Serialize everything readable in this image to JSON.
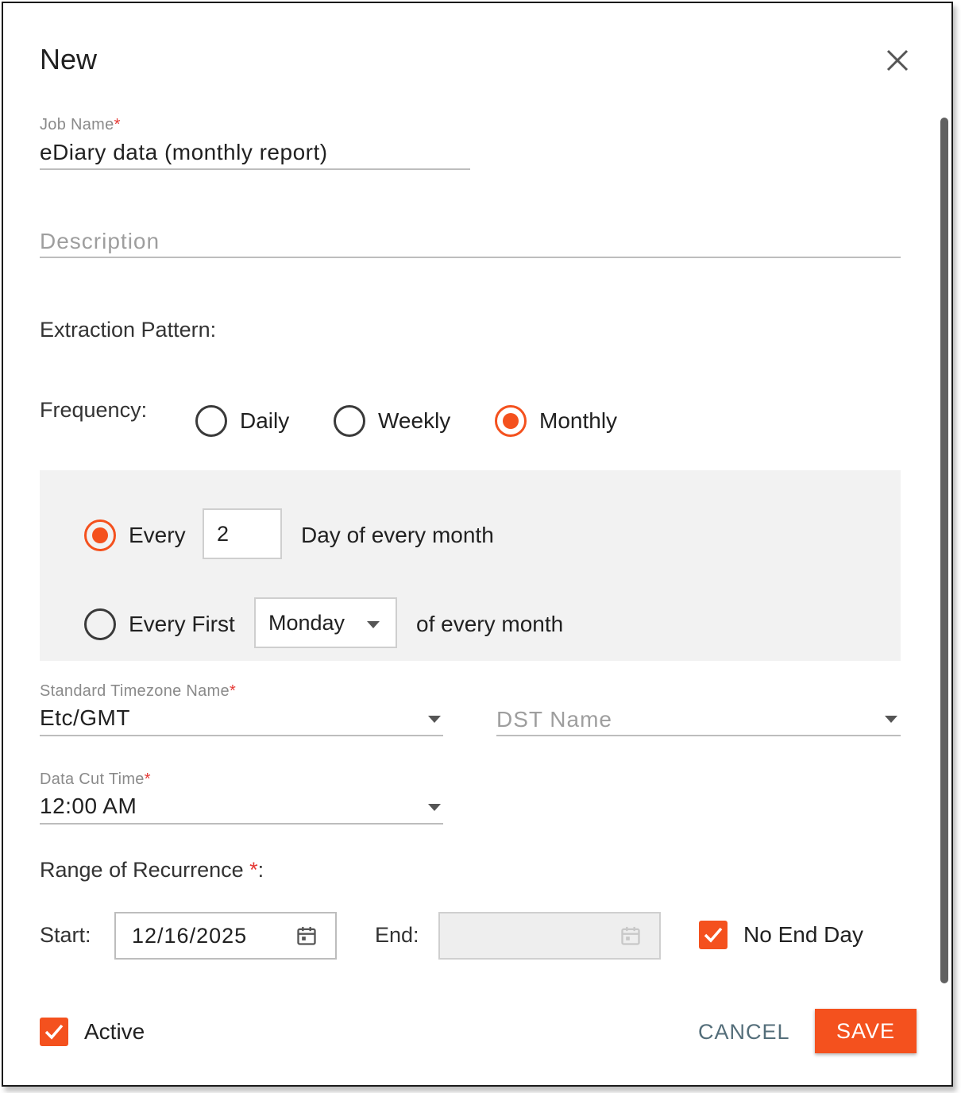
{
  "dialog": {
    "title": "New"
  },
  "job_name": {
    "label": "Job Name",
    "required_mark": "*",
    "value": "eDiary data (monthly report)"
  },
  "description": {
    "placeholder": "Description"
  },
  "extraction_pattern": {
    "heading": "Extraction Pattern:"
  },
  "frequency": {
    "label": "Frequency:",
    "options": [
      "Daily",
      "Weekly",
      "Monthly"
    ],
    "selected": "Monthly"
  },
  "monthly": {
    "every_label": "Every",
    "every_value": "2",
    "every_suffix": "Day of every month",
    "every_first_label": "Every First",
    "weekday_value": "Monday",
    "every_first_suffix": "of every month",
    "selected": "Every"
  },
  "timezone": {
    "label": "Standard Timezone Name",
    "required_mark": "*",
    "value": "Etc/GMT"
  },
  "dst": {
    "placeholder": "DST Name"
  },
  "data_cut_time": {
    "label": "Data Cut Time",
    "required_mark": "*",
    "value": "12:00 AM"
  },
  "range": {
    "label": "Range of Recurrence ",
    "required_mark": "*",
    "colon": ":",
    "start_label": "Start:",
    "start_value": "12/16/2025",
    "end_label": "End:",
    "end_value": "",
    "no_end_day_label": "No End Day",
    "no_end_day_checked": true
  },
  "footer": {
    "active_label": "Active",
    "active_checked": true,
    "cancel_label": "CANCEL",
    "save_label": "SAVE"
  },
  "colors": {
    "accent": "#f4511e",
    "cancel_text": "#546e7a",
    "required": "#e53935"
  },
  "icons": [
    "close-icon",
    "calendar-icon",
    "chevron-down-icon",
    "check-icon"
  ]
}
